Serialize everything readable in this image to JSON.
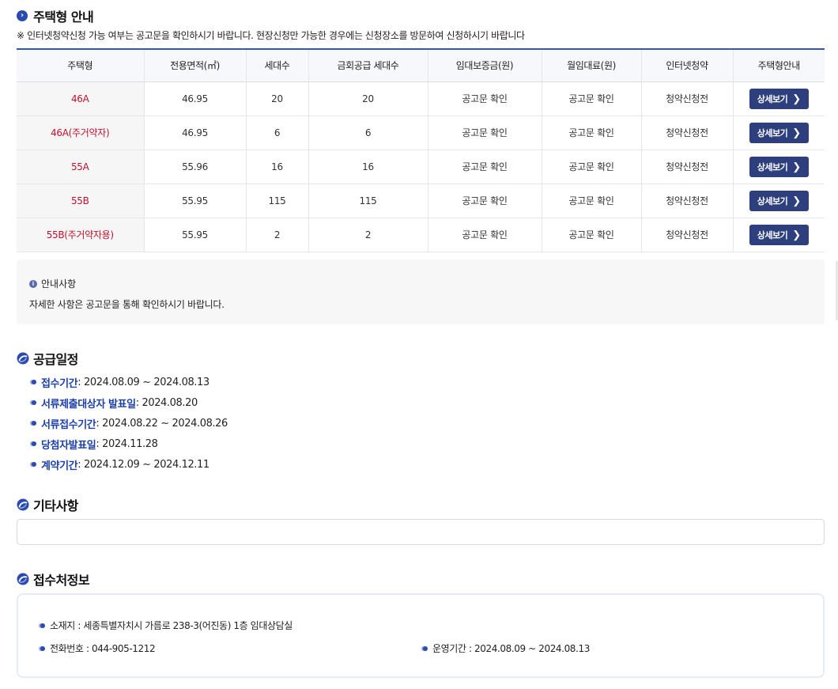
{
  "housing": {
    "title": "주택형 안내",
    "notice": "※ 인터넷청약신청 가능 여부는 공고문을 확인하시기 바랍니다. 현장신청만 가능한 경우에는 신청장소를 방문하여 신청하시기 바랍니다",
    "columns": [
      "주택형",
      "전용면적(㎡)",
      "세대수",
      "금회공급 세대수",
      "임대보증금(원)",
      "월임대료(원)",
      "인터넷청약",
      "주택형안내"
    ],
    "rows": [
      {
        "type": "46A",
        "area": "46.95",
        "units": "20",
        "supply": "20",
        "deposit": "공고문 확인",
        "rent": "공고문 확인",
        "online": "청약신청전",
        "button": "상세보기"
      },
      {
        "type": "46A(주거약자)",
        "area": "46.95",
        "units": "6",
        "supply": "6",
        "deposit": "공고문 확인",
        "rent": "공고문 확인",
        "online": "청약신청전",
        "button": "상세보기"
      },
      {
        "type": "55A",
        "area": "55.96",
        "units": "16",
        "supply": "16",
        "deposit": "공고문 확인",
        "rent": "공고문 확인",
        "online": "청약신청전",
        "button": "상세보기"
      },
      {
        "type": "55B",
        "area": "55.95",
        "units": "115",
        "supply": "115",
        "deposit": "공고문 확인",
        "rent": "공고문 확인",
        "online": "청약신청전",
        "button": "상세보기"
      },
      {
        "type": "55B(주거약자용)",
        "area": "55.95",
        "units": "2",
        "supply": "2",
        "deposit": "공고문 확인",
        "rent": "공고문 확인",
        "online": "청약신청전",
        "button": "상세보기"
      }
    ],
    "info_title": "안내사항",
    "info_text": "자세한 사항은 공고문을 통해 확인하시기 바랍니다."
  },
  "schedule": {
    "title": "공급일정",
    "items": [
      {
        "label": "접수기간",
        "value": " : 2024.08.09 ~ 2024.08.13"
      },
      {
        "label": "서류제출대상자 발표일",
        "value": " : 2024.08.20"
      },
      {
        "label": "서류접수기간",
        "value": " : 2024.08.22 ~ 2024.08.26"
      },
      {
        "label": "당첨자발표일",
        "value": " : 2024.11.28"
      },
      {
        "label": "계약기간",
        "value": " : 2024.12.09 ~ 2024.12.11"
      }
    ]
  },
  "etc": {
    "title": "기타사항"
  },
  "office": {
    "title": "접수처정보",
    "address": "소재지 : 세종특별자치시 가름로 238-3(어진동) 1층 임대상담실",
    "phone": "전화번호 : 044-905-1212",
    "hours": "운영기간 : 2024.08.09 ~ 2024.08.13"
  },
  "colors": {
    "accent": "#2f56b8",
    "type_text": "#c0102c",
    "button_bg": "#2d3f7c",
    "label_blue": "#1d3fa8"
  }
}
